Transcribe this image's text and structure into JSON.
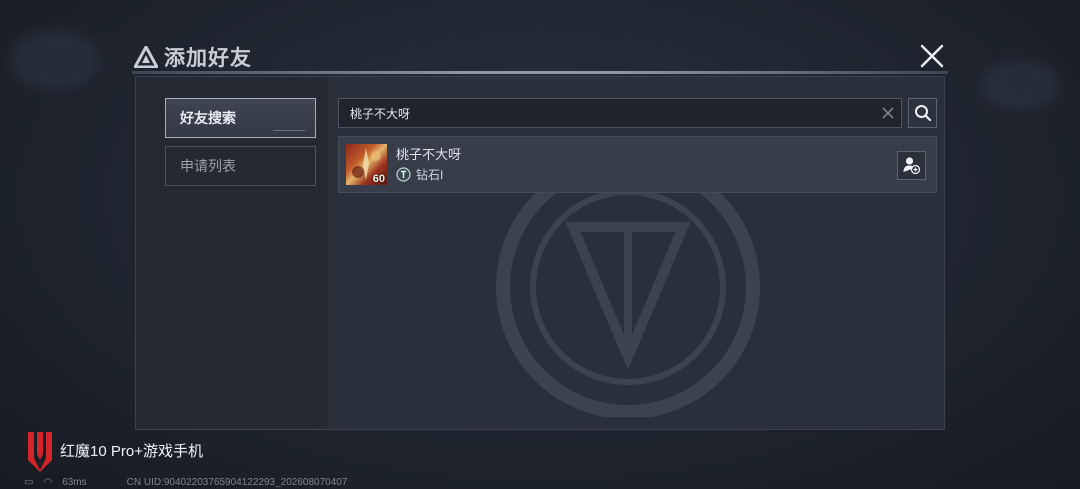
{
  "dialog": {
    "title": "添加好友"
  },
  "sidebar": {
    "tabs": [
      {
        "label": "好友搜索",
        "active": true
      },
      {
        "label": "申请列表",
        "active": false
      }
    ]
  },
  "search": {
    "value": "桃子不大呀"
  },
  "results": [
    {
      "name": "桃子不大呀",
      "level": "60",
      "rank": "钻石I"
    }
  ],
  "footer": {
    "brand": "红魔10 Pro+游戏手机",
    "ping": "63ms",
    "uid": "CN UID:9040220376590412229​3_202608070407"
  },
  "icons": {
    "close": "close-icon",
    "search": "search-icon",
    "clear": "clear-icon",
    "add_friend": "add-friend-icon",
    "rank": "rank-badge-icon"
  },
  "colors": {
    "panel_bg": "#2a3039",
    "accent_border": "#a7afba",
    "brand_red": "#d4252b"
  }
}
